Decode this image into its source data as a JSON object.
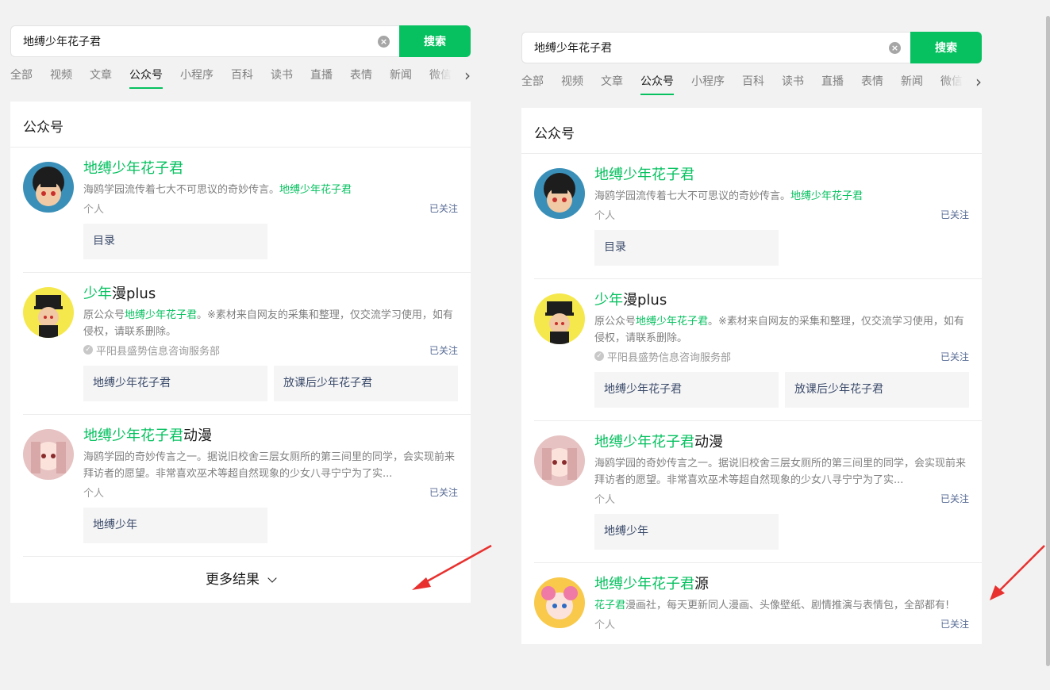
{
  "search": {
    "query": "地缚少年花子君",
    "button": "搜索"
  },
  "tabs": [
    "全部",
    "视频",
    "文章",
    "公众号",
    "小程序",
    "百科",
    "读书",
    "直播",
    "表情",
    "新闻",
    "微信"
  ],
  "active_tab": 3,
  "section_title": "公众号",
  "accounts": [
    {
      "name_hl": "地缚少年花子君",
      "name_rest": "",
      "desc_pre": "海鸥学园流传着七大不可思议的奇妙传言。",
      "desc_hl": "地缚少年花子君",
      "desc_post": "",
      "meta": "个人",
      "verified": false,
      "follow": "已关注",
      "links": [
        "目录"
      ]
    },
    {
      "name_hl": "少年",
      "name_rest": "漫plus",
      "desc_pre": "原公众号",
      "desc_hl": "地缚少年花子君",
      "desc_post": "。※素材来自网友的采集和整理，仅交流学习使用，如有侵权，请联系删除。",
      "meta": "平阳县盛势信息咨询服务部",
      "verified": true,
      "follow": "已关注",
      "links": [
        "地缚少年花子君",
        "放课后少年花子君"
      ]
    },
    {
      "name_hl": "地缚少年花子君",
      "name_rest": "动漫",
      "desc_pre": "海鸥学园的奇妙传言之一。据说旧校舍三层女厕所的第三间里的同学，会实现前来拜访者的愿望。非常喜欢巫术等超自然现象的少女八寻宁宁为了实...",
      "desc_hl": "",
      "desc_post": "",
      "meta": "个人",
      "verified": false,
      "follow": "已关注",
      "links": [
        "地缚少年"
      ]
    },
    {
      "name_hl": "地缚少年花子君",
      "name_rest": "源",
      "desc_pre": "",
      "desc_hl": "花子君",
      "desc_post": "漫画社，每天更新同人漫画、头像壁纸、剧情推演与表情包，全部都有!",
      "meta": "个人",
      "verified": false,
      "follow": "已关注",
      "links": []
    }
  ],
  "more_results": "更多结果",
  "colors": {
    "accent": "#07c160",
    "link": "#576b95",
    "annotation_arrow": "#e8312f"
  }
}
